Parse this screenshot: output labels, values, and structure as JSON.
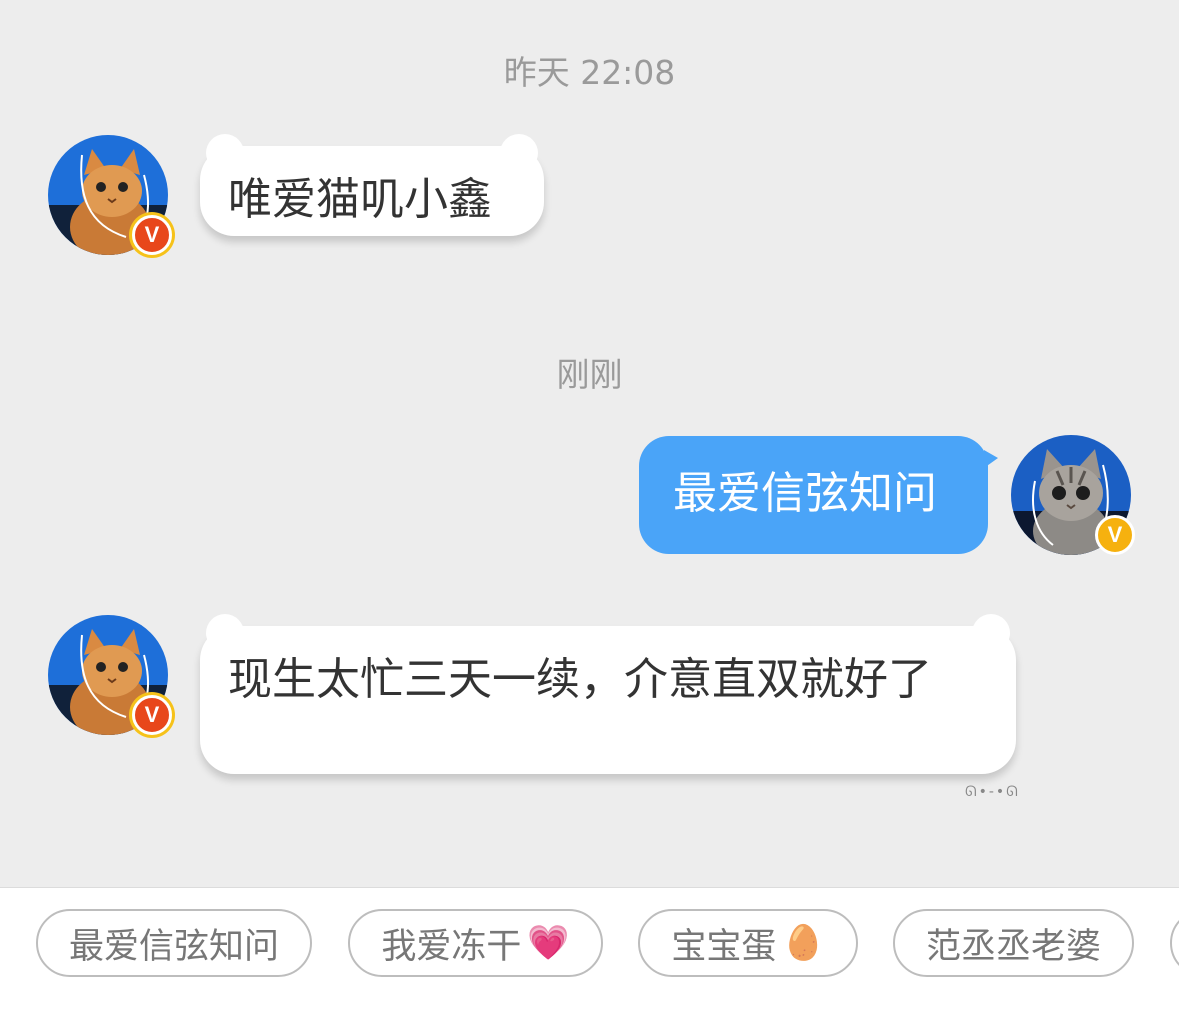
{
  "chat": {
    "timestamp_1": "昨天 22:08",
    "timestamp_2": "刚刚",
    "messages": [
      {
        "side": "left",
        "text": "唯爱猫叽小鑫"
      },
      {
        "side": "right",
        "text": "最爱信弦知问"
      },
      {
        "side": "left",
        "text": "现生太忙三天一续，介意直双就好了"
      }
    ]
  },
  "quick_replies": [
    {
      "label": "最爱信弦知问",
      "emoji": ""
    },
    {
      "label": "我爱冻干",
      "emoji": "💗"
    },
    {
      "label": "宝宝蛋",
      "emoji": "🥚"
    },
    {
      "label": "范丞丞老婆",
      "emoji": ""
    }
  ],
  "colors": {
    "background": "#ededed",
    "sent_bubble": "#4aa4f8",
    "received_bubble": "#ffffff"
  }
}
